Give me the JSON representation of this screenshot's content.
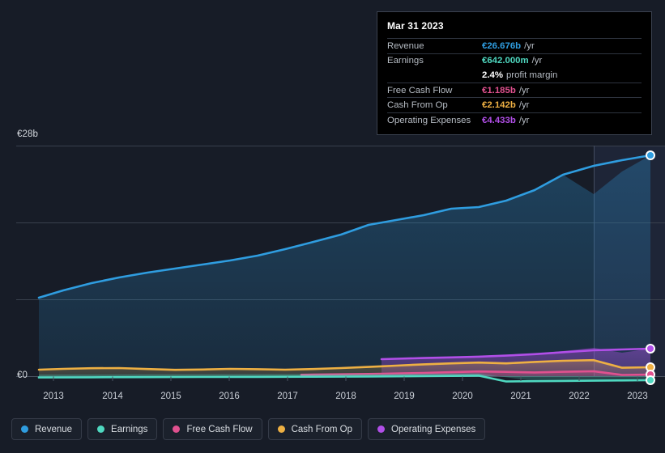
{
  "axes": {
    "y_top_label": "€28b",
    "y_zero_label": "€0",
    "x_ticks": [
      "2013",
      "2014",
      "2015",
      "2016",
      "2017",
      "2018",
      "2019",
      "2020",
      "2021",
      "2022",
      "2023"
    ]
  },
  "tooltip": {
    "date": "Mar 31 2023",
    "rows": [
      {
        "label": "Revenue",
        "value": "€26.676b",
        "suffix": "/yr",
        "color": "#2f9de0"
      },
      {
        "label": "Earnings",
        "value": "€642.000m",
        "suffix": "/yr",
        "color": "#4fd8c0"
      },
      {
        "label": "Free Cash Flow",
        "value": "€1.185b",
        "suffix": "/yr",
        "color": "#e0518f"
      },
      {
        "label": "Cash From Op",
        "value": "€2.142b",
        "suffix": "/yr",
        "color": "#eeb043"
      },
      {
        "label": "Operating Expenses",
        "value": "€4.433b",
        "suffix": "/yr",
        "color": "#b14fe8"
      }
    ],
    "profit_margin_value": "2.4%",
    "profit_margin_label": "profit margin"
  },
  "legend": {
    "items": [
      {
        "label": "Revenue",
        "color": "#2f9de0"
      },
      {
        "label": "Earnings",
        "color": "#4fd8c0"
      },
      {
        "label": "Free Cash Flow",
        "color": "#e0518f"
      },
      {
        "label": "Cash From Op",
        "color": "#eeb043"
      },
      {
        "label": "Operating Expenses",
        "color": "#b14fe8"
      }
    ]
  },
  "chart_data": {
    "type": "area",
    "title": "",
    "xlabel": "",
    "ylabel": "",
    "ylim": [
      0,
      28
    ],
    "y_unit": "€ billions",
    "xlim": [
      2012.6,
      2023.55
    ],
    "grid": true,
    "legend_position": "bottom",
    "x": [
      2012.6,
      2013.0,
      2013.5,
      2014.0,
      2014.5,
      2015.0,
      2015.5,
      2016.0,
      2016.5,
      2017.0,
      2017.5,
      2018.0,
      2018.5,
      2019.0,
      2019.5,
      2020.0,
      2020.5,
      2021.0,
      2021.5,
      2022.0,
      2022.5,
      2023.0,
      2023.25
    ],
    "forecast_start_x": 2022.15,
    "series": [
      {
        "name": "Revenue",
        "color": "#2f9de0",
        "values": [
          9.1,
          9.7,
          10.4,
          11.0,
          11.5,
          11.9,
          12.3,
          12.7,
          13.1,
          13.5,
          14.3,
          15.1,
          16.2,
          16.6,
          17.0,
          17.6,
          18.3,
          18.5,
          19.3,
          20.5,
          23.2,
          25.8,
          26.676
        ]
      },
      {
        "name": "Earnings",
        "color": "#4fd8c0",
        "values": [
          0.22,
          0.24,
          0.25,
          0.26,
          0.27,
          0.28,
          0.3,
          0.3,
          0.31,
          0.32,
          0.33,
          0.34,
          0.36,
          0.38,
          0.4,
          0.41,
          0.42,
          0.43,
          0.46,
          0.5,
          0.55,
          0.61,
          0.642
        ]
      },
      {
        "name": "Free Cash Flow",
        "color": "#e0518f",
        "start_x": 2017.0,
        "values_from_start": [
          0.35,
          0.38,
          0.42,
          0.47,
          0.5,
          0.54,
          0.62,
          0.78,
          0.9,
          0.84,
          0.92,
          1.02,
          1.11,
          1.185
        ]
      },
      {
        "name": "Cash From Op",
        "color": "#eeb043",
        "values": [
          0.8,
          0.86,
          0.92,
          0.95,
          0.88,
          0.82,
          0.86,
          0.92,
          0.88,
          0.84,
          0.88,
          0.95,
          1.05,
          1.2,
          1.32,
          1.46,
          1.62,
          1.52,
          1.7,
          1.9,
          2.05,
          2.1,
          2.142
        ]
      },
      {
        "name": "Operating Expenses",
        "color": "#b14fe8",
        "start_x": 2018.45,
        "values_from_start": [
          2.0,
          2.1,
          2.18,
          2.26,
          2.34,
          2.46,
          2.62,
          2.95,
          3.4,
          3.95,
          4.433
        ]
      }
    ]
  }
}
